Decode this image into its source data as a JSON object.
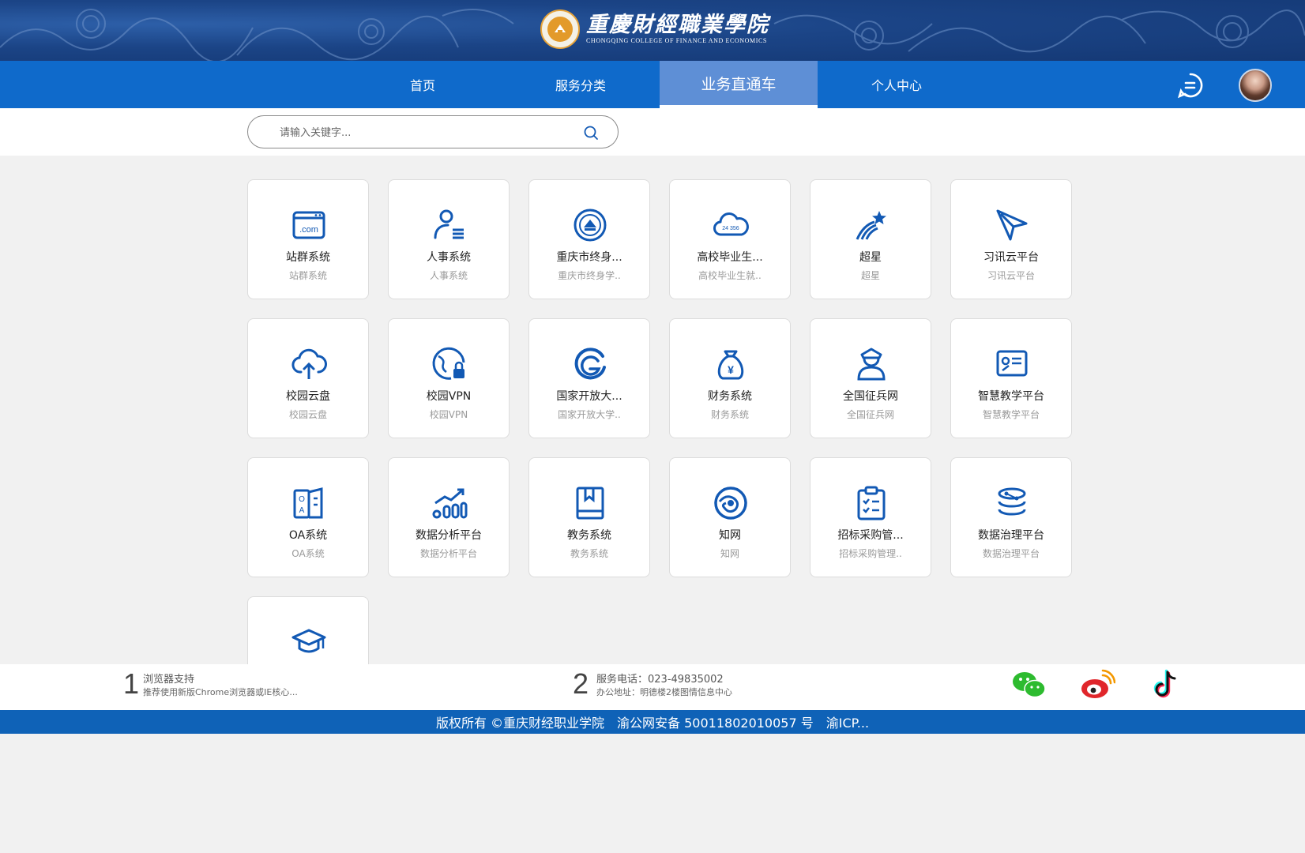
{
  "header": {
    "logo_cn": "重慶財經職業學院",
    "logo_en": "CHONGQING COLLEGE OF FINANCE AND ECONOMICS"
  },
  "nav": {
    "items": [
      {
        "label": "首页",
        "active": false
      },
      {
        "label": "服务分类",
        "active": false
      },
      {
        "label": "业务直通车",
        "active": true
      },
      {
        "label": "个人中心",
        "active": false
      }
    ]
  },
  "search": {
    "placeholder": "请输入关键字...",
    "value": ""
  },
  "accent_color": "#0f6acb",
  "icon_color": "#1259b4",
  "cards": [
    {
      "title": "站群系统",
      "subtitle": "站群系统",
      "icon": "web-domain-icon"
    },
    {
      "title": "人事系统",
      "subtitle": "人事系统",
      "icon": "user-list-icon"
    },
    {
      "title": "重庆市终身...",
      "subtitle": "重庆市终身学..",
      "icon": "seal-badge-icon"
    },
    {
      "title": "高校毕业生...",
      "subtitle": "高校毕业生就..",
      "icon": "cloud-24365-icon"
    },
    {
      "title": "超星",
      "subtitle": "超星",
      "icon": "shooting-star-icon"
    },
    {
      "title": "习讯云平台",
      "subtitle": "习讯云平台",
      "icon": "paper-plane-icon"
    },
    {
      "title": "校园云盘",
      "subtitle": "校园云盘",
      "icon": "cloud-upload-icon"
    },
    {
      "title": "校园VPN",
      "subtitle": "校园VPN",
      "icon": "globe-lock-icon"
    },
    {
      "title": "国家开放大...",
      "subtitle": "国家开放大学..",
      "icon": "open-university-icon"
    },
    {
      "title": "财务系统",
      "subtitle": "财务系统",
      "icon": "money-bag-icon"
    },
    {
      "title": "全国征兵网",
      "subtitle": "全国征兵网",
      "icon": "soldier-icon"
    },
    {
      "title": "智慧教学平台",
      "subtitle": "智慧教学平台",
      "icon": "smart-board-icon"
    },
    {
      "title": "OA系统",
      "subtitle": "OA系统",
      "icon": "oa-book-icon"
    },
    {
      "title": "数据分析平台",
      "subtitle": "数据分析平台",
      "icon": "trend-chart-icon"
    },
    {
      "title": "教务系统",
      "subtitle": "教务系统",
      "icon": "bookmark-book-icon"
    },
    {
      "title": "知网",
      "subtitle": "知网",
      "icon": "cnki-globe-icon"
    },
    {
      "title": "招标采购管...",
      "subtitle": "招标采购管理..",
      "icon": "clipboard-check-icon"
    },
    {
      "title": "数据治理平台",
      "subtitle": "数据治理平台",
      "icon": "database-icon"
    },
    {
      "title": "",
      "subtitle": "",
      "icon": "graduation-cap-icon"
    }
  ],
  "footer": {
    "browser": {
      "num": "1",
      "title": "浏览器支持",
      "sub": "推荐使用新版Chrome浏览器或IE核心..."
    },
    "service": {
      "num": "2",
      "title": "服务电话：023-49835002",
      "sub": "办公地址：明德楼2楼图情信息中心"
    },
    "social": [
      "wechat-icon",
      "weibo-icon",
      "tiktok-icon"
    ]
  },
  "copyright": "版权所有 ©重庆财经职业学院　渝公网安备 50011802010057 号　渝ICP..."
}
